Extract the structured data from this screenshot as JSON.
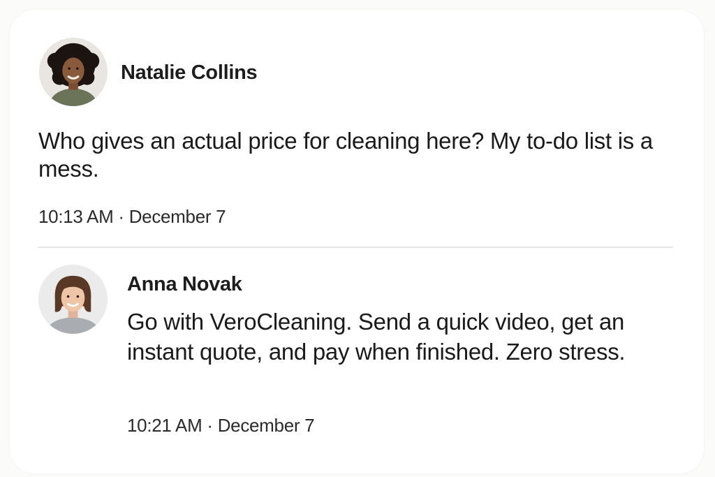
{
  "post": {
    "author": "Natalie Collins",
    "avatar_icon": "woman-curly-hair-avatar",
    "text": "Who gives an actual price for cleaning here? My to-do list is a mess.",
    "time": "10:13 AM",
    "date": "December 7"
  },
  "reply": {
    "author": "Anna Novak",
    "avatar_icon": "woman-bob-hair-avatar",
    "text": "Go with VeroCleaning. Send a quick video, get an instant quote, and pay when finished. Zero stress.",
    "time": "10:21 AM",
    "date": "December 7"
  },
  "separator": "·",
  "colors": {
    "card_background": "#ffffff",
    "text": "#1a1a1a",
    "divider": "#e4e4e2"
  }
}
